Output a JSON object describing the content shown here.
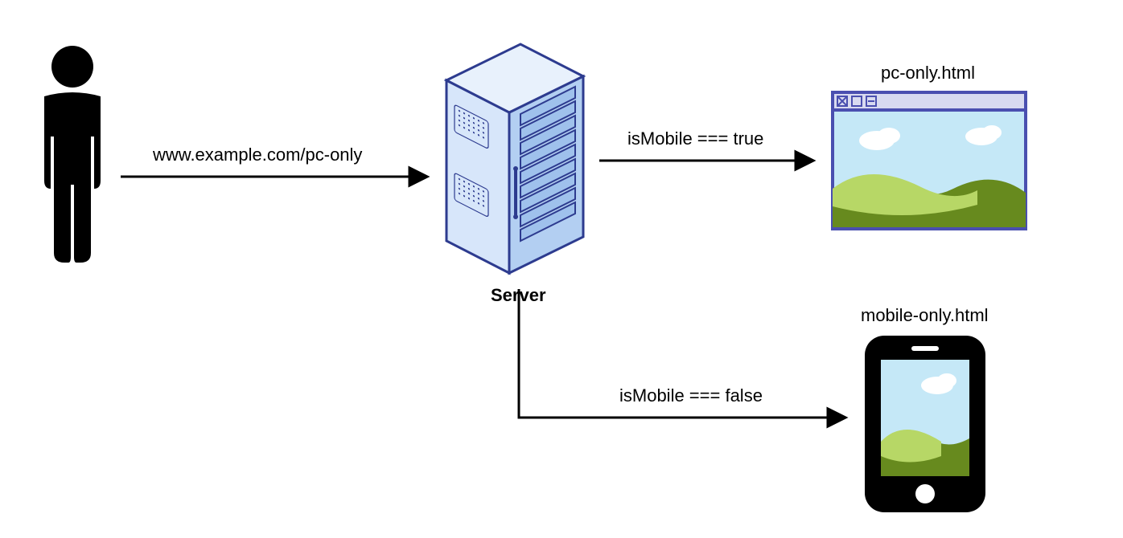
{
  "nodes": {
    "user": {
      "icon": "person-icon"
    },
    "server": {
      "label": "Server",
      "icon": "server-icon"
    },
    "pc": {
      "label": "pc-only.html",
      "icon": "browser-window-icon"
    },
    "mobile": {
      "label": "mobile-only.html",
      "icon": "phone-icon"
    }
  },
  "edges": {
    "request": {
      "label": "www.example.com/pc-only"
    },
    "toPcTrue": {
      "label": "isMobile === true"
    },
    "toMobileFalse": {
      "label": "isMobile === false"
    }
  },
  "colors": {
    "stroke": "#000000",
    "serverFace": "#B3CFF2",
    "serverFaceLight": "#D7E6FA",
    "serverEdge": "#2D3B8F",
    "sky": "#C5E8F7",
    "hillDark": "#678A1E",
    "hillLight": "#B7D766",
    "cloud": "#FFFFFF",
    "windowFrame": "#4A4FB0"
  }
}
